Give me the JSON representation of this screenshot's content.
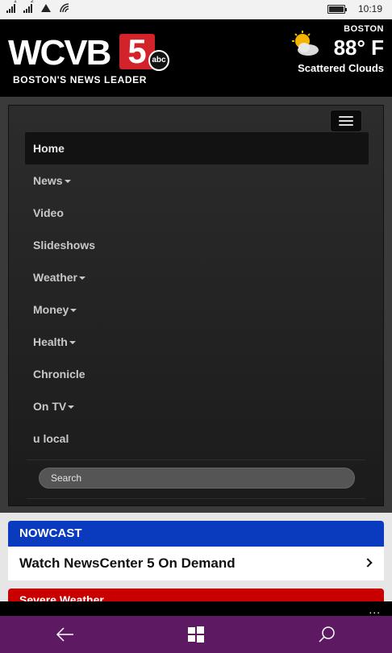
{
  "status_bar": {
    "sim1_label": "1",
    "sim2_label": "2",
    "time": "10:19"
  },
  "header": {
    "logo_callsign": "WCVB",
    "logo_channel": "5",
    "logo_network": "abc",
    "tagline": "BOSTON'S NEWS LEADER",
    "weather": {
      "city": "BOSTON",
      "temperature": "88° F",
      "condition": "Scattered Clouds",
      "icon": "partly-cloudy-icon"
    }
  },
  "nav": {
    "toggle_icon": "hamburger-menu-icon",
    "items": [
      {
        "label": "Home",
        "dropdown": false,
        "active": true
      },
      {
        "label": "News",
        "dropdown": true,
        "active": false
      },
      {
        "label": "Video",
        "dropdown": false,
        "active": false
      },
      {
        "label": "Slideshows",
        "dropdown": false,
        "active": false
      },
      {
        "label": "Weather",
        "dropdown": true,
        "active": false
      },
      {
        "label": "Money",
        "dropdown": true,
        "active": false
      },
      {
        "label": "Health",
        "dropdown": true,
        "active": false
      },
      {
        "label": "Chronicle",
        "dropdown": false,
        "active": false
      },
      {
        "label": "On TV",
        "dropdown": true,
        "active": false
      },
      {
        "label": "u local",
        "dropdown": false,
        "active": false
      }
    ],
    "search_placeholder": "Search"
  },
  "content": {
    "nowcast_label": "NOWCAST",
    "ondemand_label": "Watch NewsCenter 5 On Demand",
    "severe_label": "Severe Weather"
  },
  "app_bar": {
    "more_label": "..."
  },
  "taskbar": {
    "back_icon": "back-arrow-icon",
    "start_icon": "windows-start-icon",
    "search_icon": "search-icon"
  },
  "colors": {
    "nowcast_blue": "#0a3bbf",
    "severe_red": "#c80000",
    "taskbar_purple": "#5d1a63",
    "logo_red": "#d2232a"
  }
}
